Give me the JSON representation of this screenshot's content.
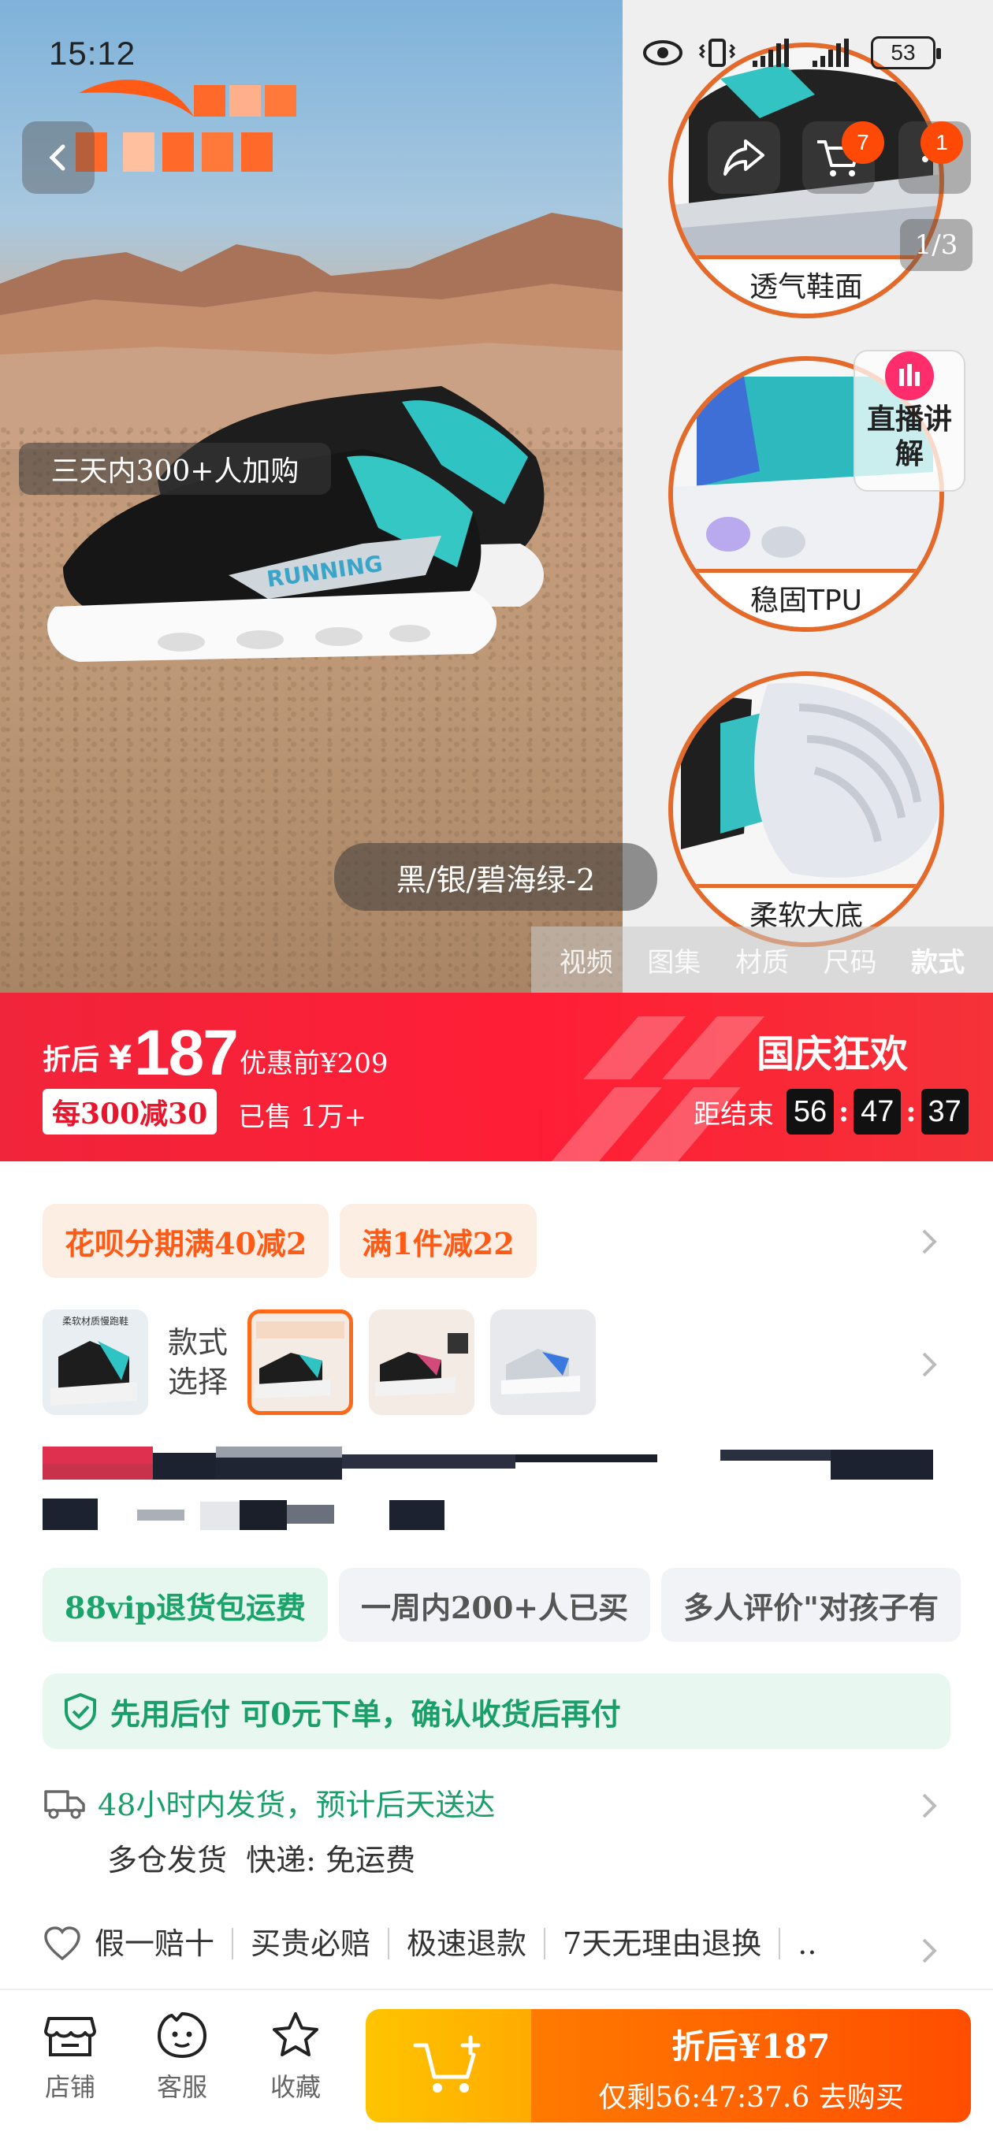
{
  "status_bar": {
    "time": "15:12",
    "battery": "53"
  },
  "colors": {
    "accent_orange": "#ff5a16",
    "banner_red": "#f0243a",
    "green": "#1a9e6a",
    "badge": "#ff4a07"
  },
  "header": {
    "cart_badge": "7",
    "more_badge": "1",
    "image_counter": "1/3"
  },
  "hero": {
    "added_text": "三天内300+人加购",
    "color_name": "黑/银/碧海绿-2",
    "details": [
      "透气鞋面",
      "稳固TPU",
      "柔软大底"
    ],
    "live_label": "直播讲解",
    "media_tabs": [
      {
        "label": "视频",
        "active": false
      },
      {
        "label": "图集",
        "active": false
      },
      {
        "label": "材质",
        "active": false
      },
      {
        "label": "尺码",
        "active": false
      },
      {
        "label": "款式",
        "active": true
      }
    ]
  },
  "price_banner": {
    "label": "折后",
    "currency": "¥",
    "price": "187",
    "original": "优惠前¥209",
    "coupon": "每300减30",
    "sold": "已售 1万+",
    "event": "国庆狂欢",
    "countdown_label": "距结束",
    "countdown": [
      "56",
      "47",
      "37"
    ]
  },
  "promos": [
    "花呗分期满40减2",
    "满1件减22"
  ],
  "style_select": {
    "label_line1": "款式",
    "label_line2": "选择",
    "thumb_caption": "柔软材质慢跑鞋"
  },
  "tags": [
    "88vip退货包运费",
    "一周内200+人已买",
    "多人评价\"对孩子有"
  ],
  "pay_banner": "先用后付 可0元下单，确认收货后再付",
  "shipping": {
    "main": "48小时内发货，预计后天送达",
    "sub": "多仓发货  快递: 免运费"
  },
  "guarantees": [
    "假一赔十",
    "买贵必赔",
    "极速退款",
    "7天无理由退换",
    ".."
  ],
  "bottom_bar": {
    "shop": "店铺",
    "service": "客服",
    "favorite": "收藏",
    "buy_line1": "折后¥187",
    "buy_line2": "仅剩56:47:37.6 去购买"
  }
}
